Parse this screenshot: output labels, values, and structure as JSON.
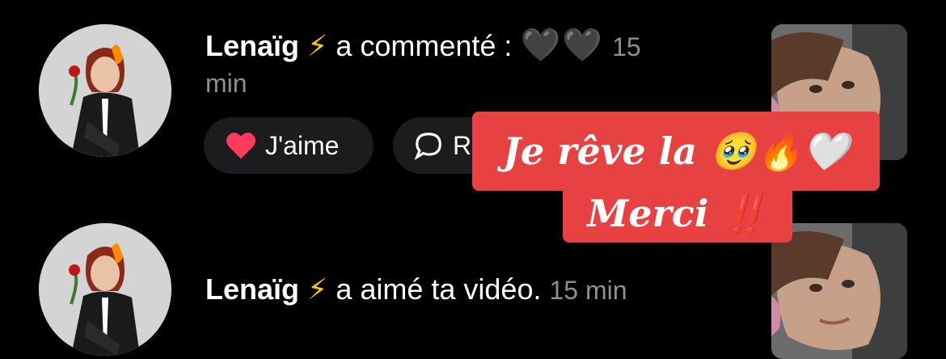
{
  "notifications": [
    {
      "username": "Lenaïg",
      "bolt": "⚡",
      "action": "a commenté :",
      "comment": "🖤🖤",
      "time_part1": "15",
      "time_part2": "min",
      "like_label": "J'aime",
      "reply_label": "R"
    },
    {
      "username": "Lenaïg",
      "bolt": "⚡",
      "action": "a aimé ta vidéo.",
      "time": "15 min"
    }
  ],
  "overlay": {
    "line1": "Je rêve la 🥹🔥🤍",
    "line2": "Merci ‼️"
  },
  "colors": {
    "background": "#000000",
    "pill": "#1c1c1e",
    "like_heart": "#ff3b5c",
    "overlay_red": "#e84142",
    "muted_text": "#8e8e93"
  }
}
